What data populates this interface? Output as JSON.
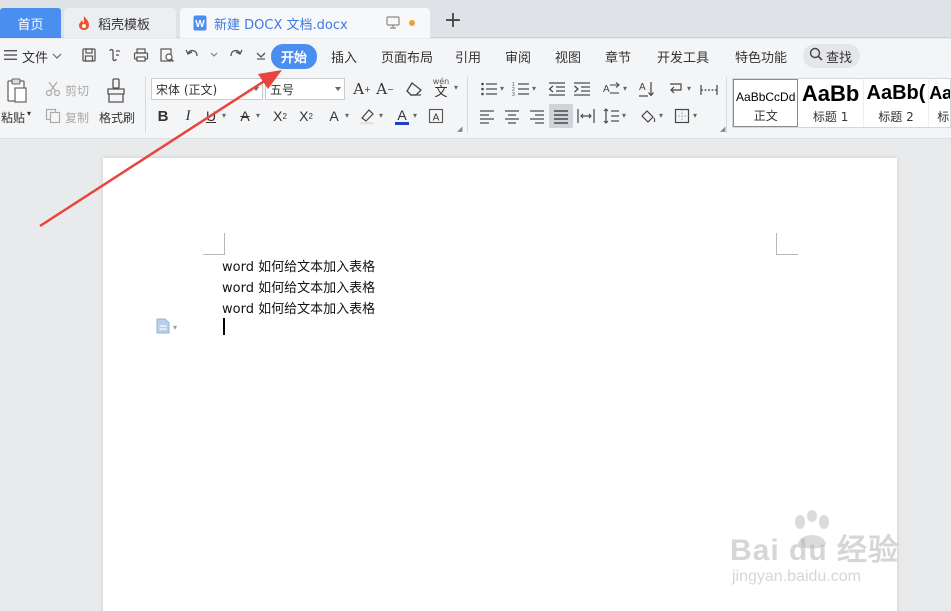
{
  "tabs": {
    "home": "首页",
    "templates": "稻壳模板",
    "document": "新建 DOCX 文档.docx",
    "add": "+"
  },
  "menu": {
    "file": "文件",
    "items": [
      "开始",
      "插入",
      "页面布局",
      "引用",
      "审阅",
      "视图",
      "章节",
      "开发工具",
      "特色功能"
    ],
    "active_index": 0,
    "search": "查找"
  },
  "ribbon": {
    "paste": "粘贴",
    "cut": "剪切",
    "copy": "复制",
    "format_painter": "格式刷",
    "font_name": "宋体 (正文)",
    "font_size": "五号",
    "phonetic": "wén",
    "styles": [
      {
        "sample": "AaBbCcDd",
        "name": "正文"
      },
      {
        "sample": "AaBb",
        "name": "标题 1"
      },
      {
        "sample": "AaBb(",
        "name": "标题 2"
      },
      {
        "sample": "Aa",
        "name": "标"
      }
    ]
  },
  "document": {
    "lines": [
      "word 如何给文本加入表格",
      "word 如何给文本加入表格",
      "word 如何给文本加入表格"
    ]
  },
  "watermark": {
    "brand": "Bai du 经验",
    "url": "jingyan.baidu.com"
  },
  "colors": {
    "accent": "#4a8ef0",
    "annotation_arrow": "#e8453c",
    "doc_tab_text": "#3e7ae0"
  }
}
